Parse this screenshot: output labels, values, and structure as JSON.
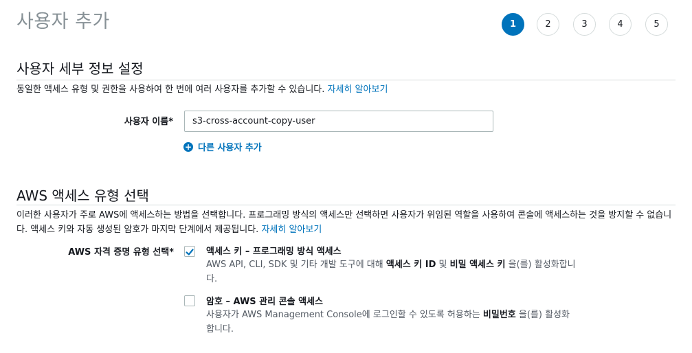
{
  "page": {
    "title": "사용자 추가"
  },
  "steps": [
    {
      "label": "1",
      "active": true
    },
    {
      "label": "2",
      "active": false
    },
    {
      "label": "3",
      "active": false
    },
    {
      "label": "4",
      "active": false
    },
    {
      "label": "5",
      "active": false
    }
  ],
  "user_details": {
    "title": "사용자 세부 정보 설정",
    "description": "동일한 액세스 유형 및 권한을 사용하여 한 번에 여러 사용자를 추가할 수 있습니다.",
    "learn_more": "자세히 알아보기",
    "username_label": "사용자 이름*",
    "username_value": "s3-cross-account-copy-user",
    "add_another_user": "다른 사용자 추가"
  },
  "access_type": {
    "title": "AWS 액세스 유형 선택",
    "description": "이러한 사용자가 주로 AWS에 액세스하는 방법을 선택합니다. 프로그래밍 방식의 액세스만 선택하면 사용자가 위임된 역할을 사용하여 콘솔에 액세스하는 것을 방지할 수 없습니다. 액세스 키와 자동 생성된 암호가 마지막 단계에서 제공됩니다.",
    "learn_more": "자세히 알아보기",
    "credential_label": "AWS 자격 증명 유형 선택*",
    "options": [
      {
        "title": "액세스 키 – 프로그래밍 방식 액세스",
        "checked": true,
        "desc_pre": "AWS API, CLI, SDK 및 기타 개발 도구에 대해 ",
        "desc_b1": "액세스 키 ID",
        "desc_mid": " 및 ",
        "desc_b2": "비밀 액세스 키",
        "desc_post": " 을(를) 활성화합니다."
      },
      {
        "title": "암호 – AWS 관리 콘솔 액세스",
        "checked": false,
        "desc_pre": "사용자가 AWS Management Console에 로그인할 수 있도록 허용하는 ",
        "desc_b1": "비밀번호",
        "desc_post": " 을(를) 활성화합니다."
      }
    ]
  },
  "colors": {
    "accent": "#0073bb",
    "muted_title": "#879196",
    "border": "#d5dbdb"
  }
}
